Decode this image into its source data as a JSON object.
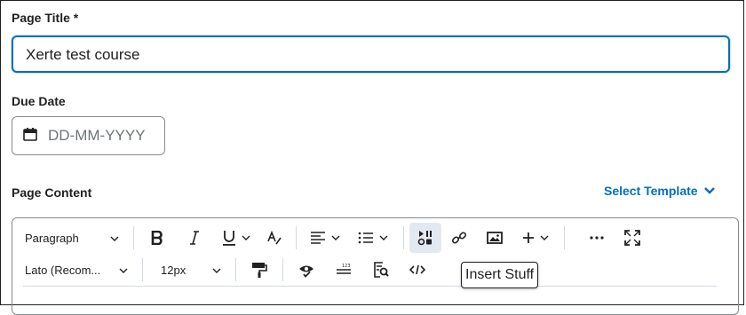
{
  "page_title_field": {
    "label": "Page Title *",
    "value": "Xerte test course"
  },
  "due_date_field": {
    "label": "Due Date",
    "placeholder": "DD-MM-YYYY",
    "icon": "calendar-icon"
  },
  "page_content": {
    "label": "Page Content",
    "select_template_label": "Select Template"
  },
  "toolbar": {
    "block_format": "Paragraph",
    "font_family": "Lato (Recom...",
    "font_size": "12px",
    "icons": [
      "bold-icon",
      "italic-icon",
      "underline-icon",
      "strikethrough-icon",
      "align-icon",
      "list-icon",
      "insert-stuff-icon",
      "link-icon",
      "image-icon",
      "plus-icon",
      "more-icon",
      "fullscreen-icon",
      "format-painter-icon",
      "accessibility-checker-icon",
      "word-count-icon",
      "find-replace-icon",
      "source-code-icon"
    ]
  },
  "tooltip": {
    "text": "Insert Stuff"
  },
  "colors": {
    "accent": "#006fbf",
    "border": "#868c8f",
    "text": "#202122",
    "placeholder": "#6e7477"
  }
}
